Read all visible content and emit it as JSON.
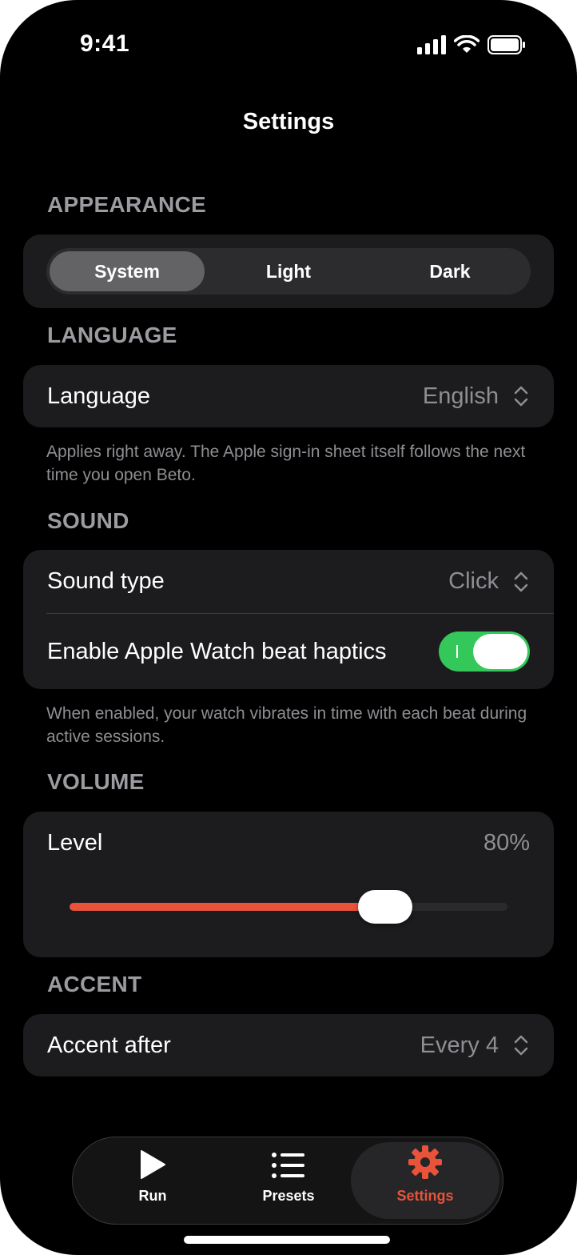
{
  "status_bar": {
    "time": "9:41",
    "icons": [
      "cellular-signal-icon",
      "wifi-icon",
      "battery-icon"
    ]
  },
  "nav": {
    "title": "Settings"
  },
  "appearance": {
    "header": "APPEARANCE",
    "options": [
      "System",
      "Light",
      "Dark"
    ],
    "selected": "System"
  },
  "language": {
    "header": "LANGUAGE",
    "label": "Language",
    "value": "English",
    "footnote": "Applies right away. The Apple sign-in sheet itself follows the next time you open Beto."
  },
  "sound": {
    "header": "SOUND",
    "type_label": "Sound type",
    "type_value": "Click",
    "haptics_label": "Enable Apple Watch beat haptics",
    "haptics_enabled": true,
    "footnote": "When enabled, your watch vibrates in time with each beat during active sessions."
  },
  "volume": {
    "header": "VOLUME",
    "label": "Level",
    "value_text": "80%",
    "level_fraction": 0.72
  },
  "accent": {
    "header": "ACCENT",
    "label": "Accent after",
    "value": "Every 4"
  },
  "tab_bar": {
    "tabs": [
      {
        "label": "Run",
        "icon": "play-icon"
      },
      {
        "label": "Presets",
        "icon": "list-icon"
      },
      {
        "label": "Settings",
        "icon": "gear-icon"
      }
    ],
    "active": "Settings"
  },
  "colors": {
    "background": "#000000",
    "card": "#1c1c1e",
    "accent": "#e8533a",
    "toggle_on": "#34c759",
    "secondary_text": "#8e8e93"
  }
}
